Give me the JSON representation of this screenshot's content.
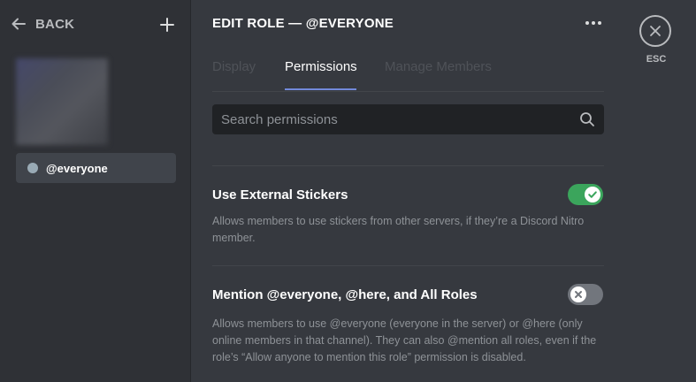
{
  "sidebar": {
    "back_label": "BACK",
    "add_icon": "plus-icon",
    "roles": [
      {
        "label": "@everyone",
        "color": "#99aab5"
      }
    ]
  },
  "header": {
    "title": "EDIT ROLE — @EVERYONE",
    "more_icon": "more-options-icon"
  },
  "tabs": [
    {
      "label": "Display",
      "active": false
    },
    {
      "label": "Permissions",
      "active": true
    },
    {
      "label": "Manage Members",
      "active": false
    }
  ],
  "search": {
    "placeholder": "Search permissions",
    "value": ""
  },
  "permissions": [
    {
      "title": "Use External Stickers",
      "description": "Allows members to use stickers from other servers, if they’re a Discord Nitro member.",
      "enabled": true
    },
    {
      "title": "Mention @everyone, @here, and All Roles",
      "description": "Allows members to use @everyone (everyone in the server) or @here (only online members in that channel). They can also @mention all roles, even if the role’s “Allow anyone to mention this role” permission is disabled.",
      "enabled": false
    }
  ],
  "esc": {
    "label": "ESC"
  },
  "colors": {
    "accent": "#7289da",
    "toggle_on": "#3ba55c",
    "toggle_off": "#72767d"
  }
}
